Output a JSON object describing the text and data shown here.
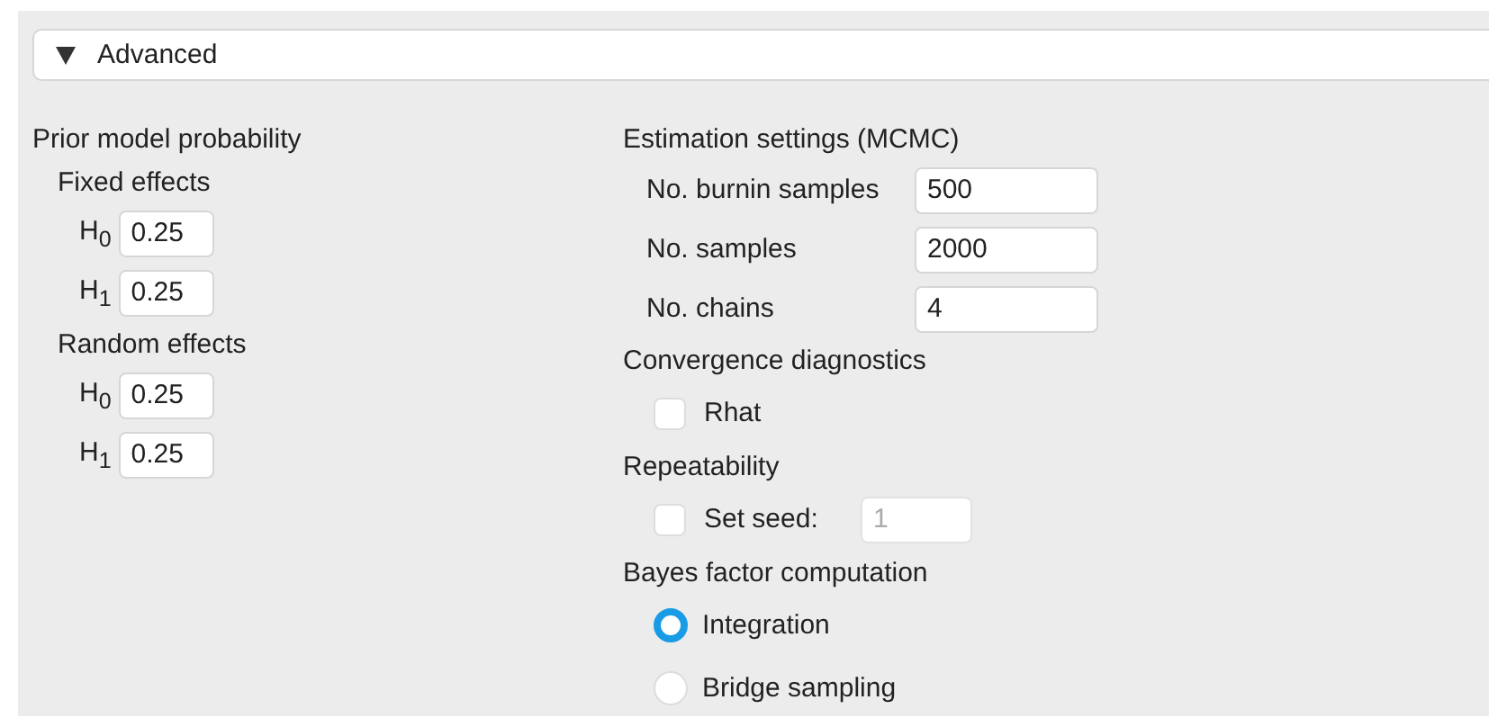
{
  "section": {
    "title": "Advanced",
    "expanded": true
  },
  "prior": {
    "title": "Prior model probability",
    "groups": [
      {
        "title": "Fixed effects",
        "fields": [
          {
            "label": "H$_{0}$",
            "value": "0.25"
          },
          {
            "label": "H$_{1}$",
            "value": "0.25"
          }
        ]
      },
      {
        "title": "Random effects",
        "fields": [
          {
            "label": "H$_{0}$",
            "value": "0.25"
          },
          {
            "label": "H$_{1}$",
            "value": "0.25"
          }
        ]
      }
    ]
  },
  "estimation": {
    "title": "Estimation settings (MCMC)",
    "fields": [
      {
        "label": "No. burnin samples",
        "value": "500"
      },
      {
        "label": "No. samples",
        "value": "2000"
      },
      {
        "label": "No. chains",
        "value": "4"
      }
    ]
  },
  "convergence": {
    "title": "Convergence diagnostics",
    "options": [
      {
        "label": "Rhat",
        "checked": false
      }
    ]
  },
  "repeatability": {
    "title": "Repeatability",
    "seed": {
      "label": "Set seed:",
      "checked": false,
      "value": "1",
      "disabled": true
    }
  },
  "bayes_factor": {
    "title": "Bayes factor computation",
    "options": [
      {
        "label": "Integration",
        "selected": true
      },
      {
        "label": "Bridge sampling",
        "selected": false
      }
    ]
  }
}
